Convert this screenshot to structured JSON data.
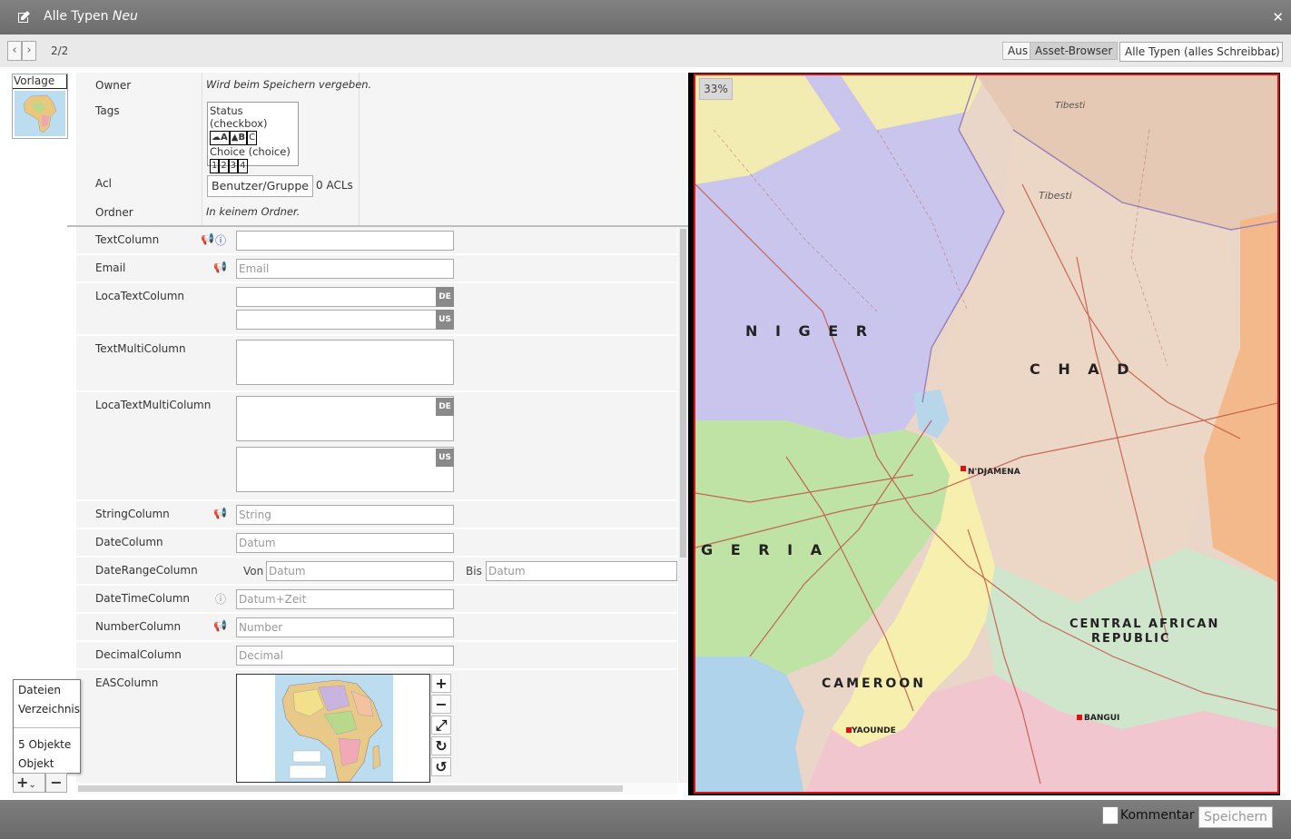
{
  "window": {
    "title": "Alle Typen",
    "title_state": "Neu"
  },
  "toolbar": {
    "pager": "2/2",
    "toggle_off": "Aus",
    "toggle_on": "Asset-Browser",
    "type_select": "Alle Typen (alles Schreibbar)"
  },
  "preview_thumb": {
    "label": "Vorlage"
  },
  "meta": {
    "owner_label": "Owner",
    "owner_value": "Wird beim Speichern vergeben.",
    "tags_label": "Tags",
    "tags_group1": "Status (checkbox)",
    "tags_group1_chips": [
      "A",
      "B",
      "C"
    ],
    "tags_group2": "Choice (choice)",
    "tags_group2_chips": [
      "1",
      "2",
      "3",
      "4"
    ],
    "acl_label": "Acl",
    "acl_button": "Benutzer/Gruppe",
    "acl_count": "0 ACLs",
    "folder_label": "Ordner",
    "folder_value": "In keinem Ordner."
  },
  "form": {
    "text_label": "TextColumn",
    "email_label": "Email",
    "email_placeholder": "Email",
    "locatext_label": "LocaTextColumn",
    "lang_de": "DE",
    "lang_us": "US",
    "textmulti_label": "TextMultiColumn",
    "locatextmulti_label": "LocaTextMultiColumn",
    "string_label": "StringColumn",
    "string_placeholder": "String",
    "date_label": "DateColumn",
    "date_placeholder": "Datum",
    "daterange_label": "DateRangeColumn",
    "from_label": "Von",
    "to_label": "Bis",
    "datetime_label": "DateTimeColumn",
    "datetime_placeholder": "Datum+Zeit",
    "number_label": "NumberColumn",
    "number_placeholder": "Number",
    "decimal_label": "DecimalColumn",
    "decimal_placeholder": "Decimal",
    "eas_label": "EASColumn"
  },
  "viewer": {
    "zoom": "33%",
    "map_labels": [
      "NIGER",
      "CHAD",
      "CAMEROON",
      "CENTRAL AFRICAN",
      "REPUBLIC",
      "GERIA",
      "N'DJAMENA",
      "YAOUNDE",
      "BANGUI",
      "Tibesti",
      "Tibesti"
    ]
  },
  "popup": {
    "items": [
      "Dateien",
      "Verzeichnis",
      "5 Objekte",
      "Objekt"
    ]
  },
  "footer": {
    "comment_label": "Kommentar",
    "save_label": "Speichern"
  },
  "colors": {
    "accent_border": "#d11111",
    "titlebar": "#767676",
    "icon_blue": "#1f3fd0"
  }
}
